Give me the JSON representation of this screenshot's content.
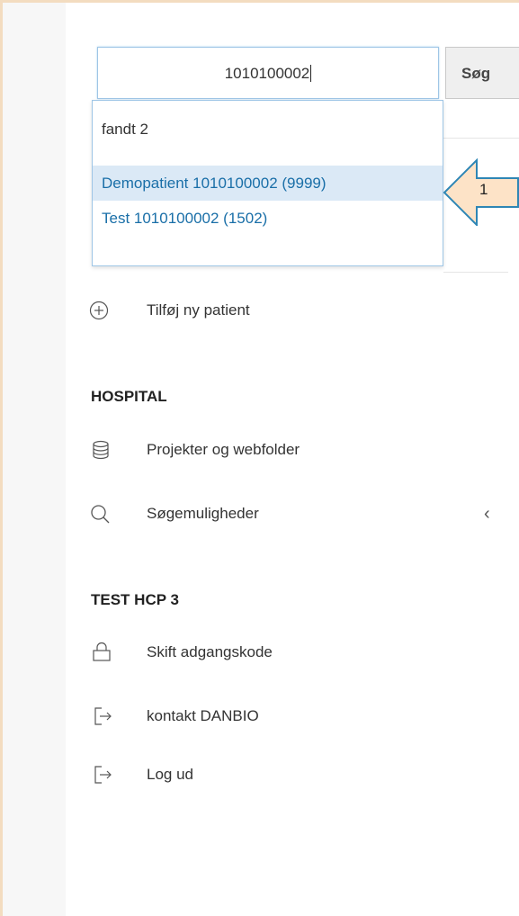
{
  "search": {
    "value": "1010100002",
    "button_label": "Søg"
  },
  "results": {
    "count_label": "fandt 2",
    "items": [
      {
        "label": "Demopatient 1010100002 (9999)",
        "selected": true
      },
      {
        "label": "Test 1010100002 (1502)",
        "selected": false
      }
    ]
  },
  "callout": {
    "number": "1"
  },
  "menu": {
    "add_patient": "Tilføj ny patient",
    "hospital_heading": "HOSPITAL",
    "hospital_items": [
      {
        "label": "Projekter og webfolder",
        "icon": "database-icon"
      },
      {
        "label": "Søgemuligheder",
        "icon": "search-icon"
      }
    ],
    "user_heading": "TEST HCP 3",
    "user_items": [
      {
        "label": "Skift adgangskode",
        "icon": "lock-icon"
      },
      {
        "label": "kontakt DANBIO",
        "icon": "exit-icon"
      },
      {
        "label": "Log ud",
        "icon": "logout-icon"
      }
    ]
  },
  "colors": {
    "link": "#1a6fa8",
    "selected_bg": "#dbe9f6",
    "callout_fill": "#fde3c7",
    "callout_stroke": "#2e86b5"
  }
}
